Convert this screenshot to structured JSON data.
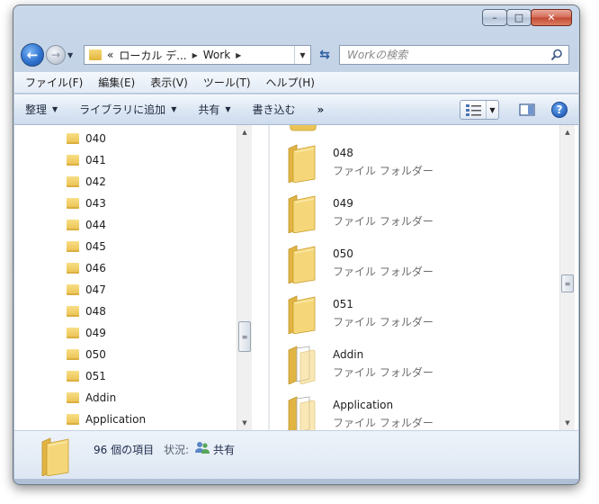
{
  "window": {
    "caption_minimize": "–",
    "caption_maximize": "□",
    "caption_close": "✕"
  },
  "address": {
    "overflow": "«",
    "crumbs": [
      "ローカル デ...",
      "Work"
    ]
  },
  "search": {
    "placeholder": "Workの検索"
  },
  "menu": [
    "ファイル(F)",
    "編集(E)",
    "表示(V)",
    "ツール(T)",
    "ヘルプ(H)"
  ],
  "toolbar": {
    "organize": "整理",
    "add_library": "ライブラリに追加",
    "share": "共有",
    "burn": "書き込む",
    "more": "»",
    "help": "?"
  },
  "nav_tree": [
    "040",
    "041",
    "042",
    "043",
    "044",
    "045",
    "046",
    "047",
    "048",
    "049",
    "050",
    "051",
    "Addin",
    "Application"
  ],
  "files": [
    {
      "name": "048",
      "type": "ファイル フォルダー"
    },
    {
      "name": "049",
      "type": "ファイル フォルダー"
    },
    {
      "name": "050",
      "type": "ファイル フォルダー"
    },
    {
      "name": "051",
      "type": "ファイル フォルダー"
    },
    {
      "name": "Addin",
      "type": "ファイル フォルダー"
    },
    {
      "name": "Application",
      "type": "ファイル フォルダー"
    }
  ],
  "status": {
    "count": "96 個の項目",
    "state_label": "状況:",
    "state_value": "共有"
  }
}
